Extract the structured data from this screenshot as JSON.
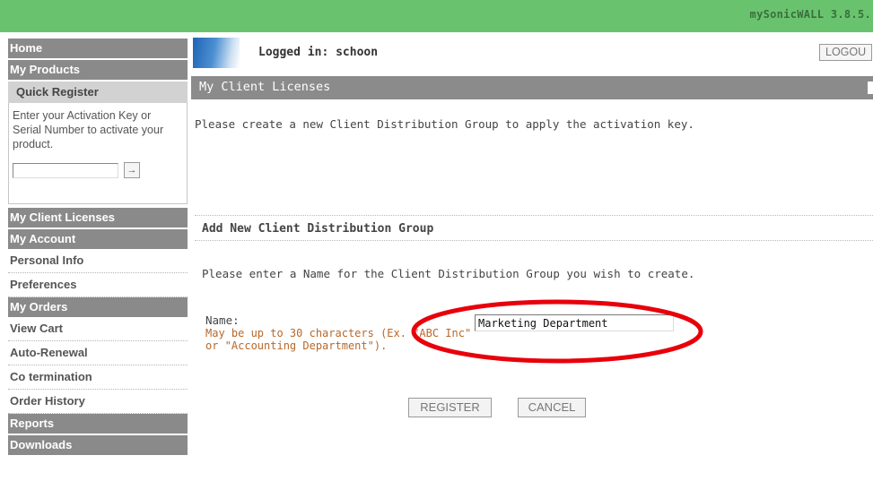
{
  "app": {
    "brand": "mySonicWALL 3.8.5."
  },
  "header": {
    "logged_in": "Logged in: schoon",
    "logout_label": "LOGOU"
  },
  "sidebar": {
    "home": "Home",
    "my_products": "My Products",
    "quick_register": {
      "title": "Quick Register",
      "text": "Enter your Activation Key or Serial Number to activate your product.",
      "input_value": "",
      "go_icon": "arrow-right-icon",
      "go_glyph": "→"
    },
    "my_client_licenses": "My Client Licenses",
    "my_account": "My Account",
    "personal_info": "Personal Info",
    "preferences": "Preferences",
    "my_orders": "My Orders",
    "view_cart": "View Cart",
    "auto_renewal": "Auto-Renewal",
    "co_termination": "Co termination",
    "order_history": "Order History",
    "reports": "Reports",
    "downloads": "Downloads"
  },
  "main": {
    "section_title": "My Client Licenses",
    "intro": "Please create a new Client Distribution Group to apply the activation key.",
    "subsection_title": "Add New Client Distribution Group",
    "description": "Please enter a Name for the Client Distribution Group you wish to create.",
    "name_label": "Name:",
    "name_hint": "May be up to 30 characters (Ex. \"ABC Inc\" or \"Accounting Department\").",
    "name_value": "Marketing Department",
    "register_label": "REGISTER",
    "cancel_label": "CANCEL"
  },
  "colors": {
    "topbar": "#69c36e",
    "nav_dark": "#8a8a8a",
    "highlight": "#e8000b",
    "hint_text": "#b8682a"
  }
}
